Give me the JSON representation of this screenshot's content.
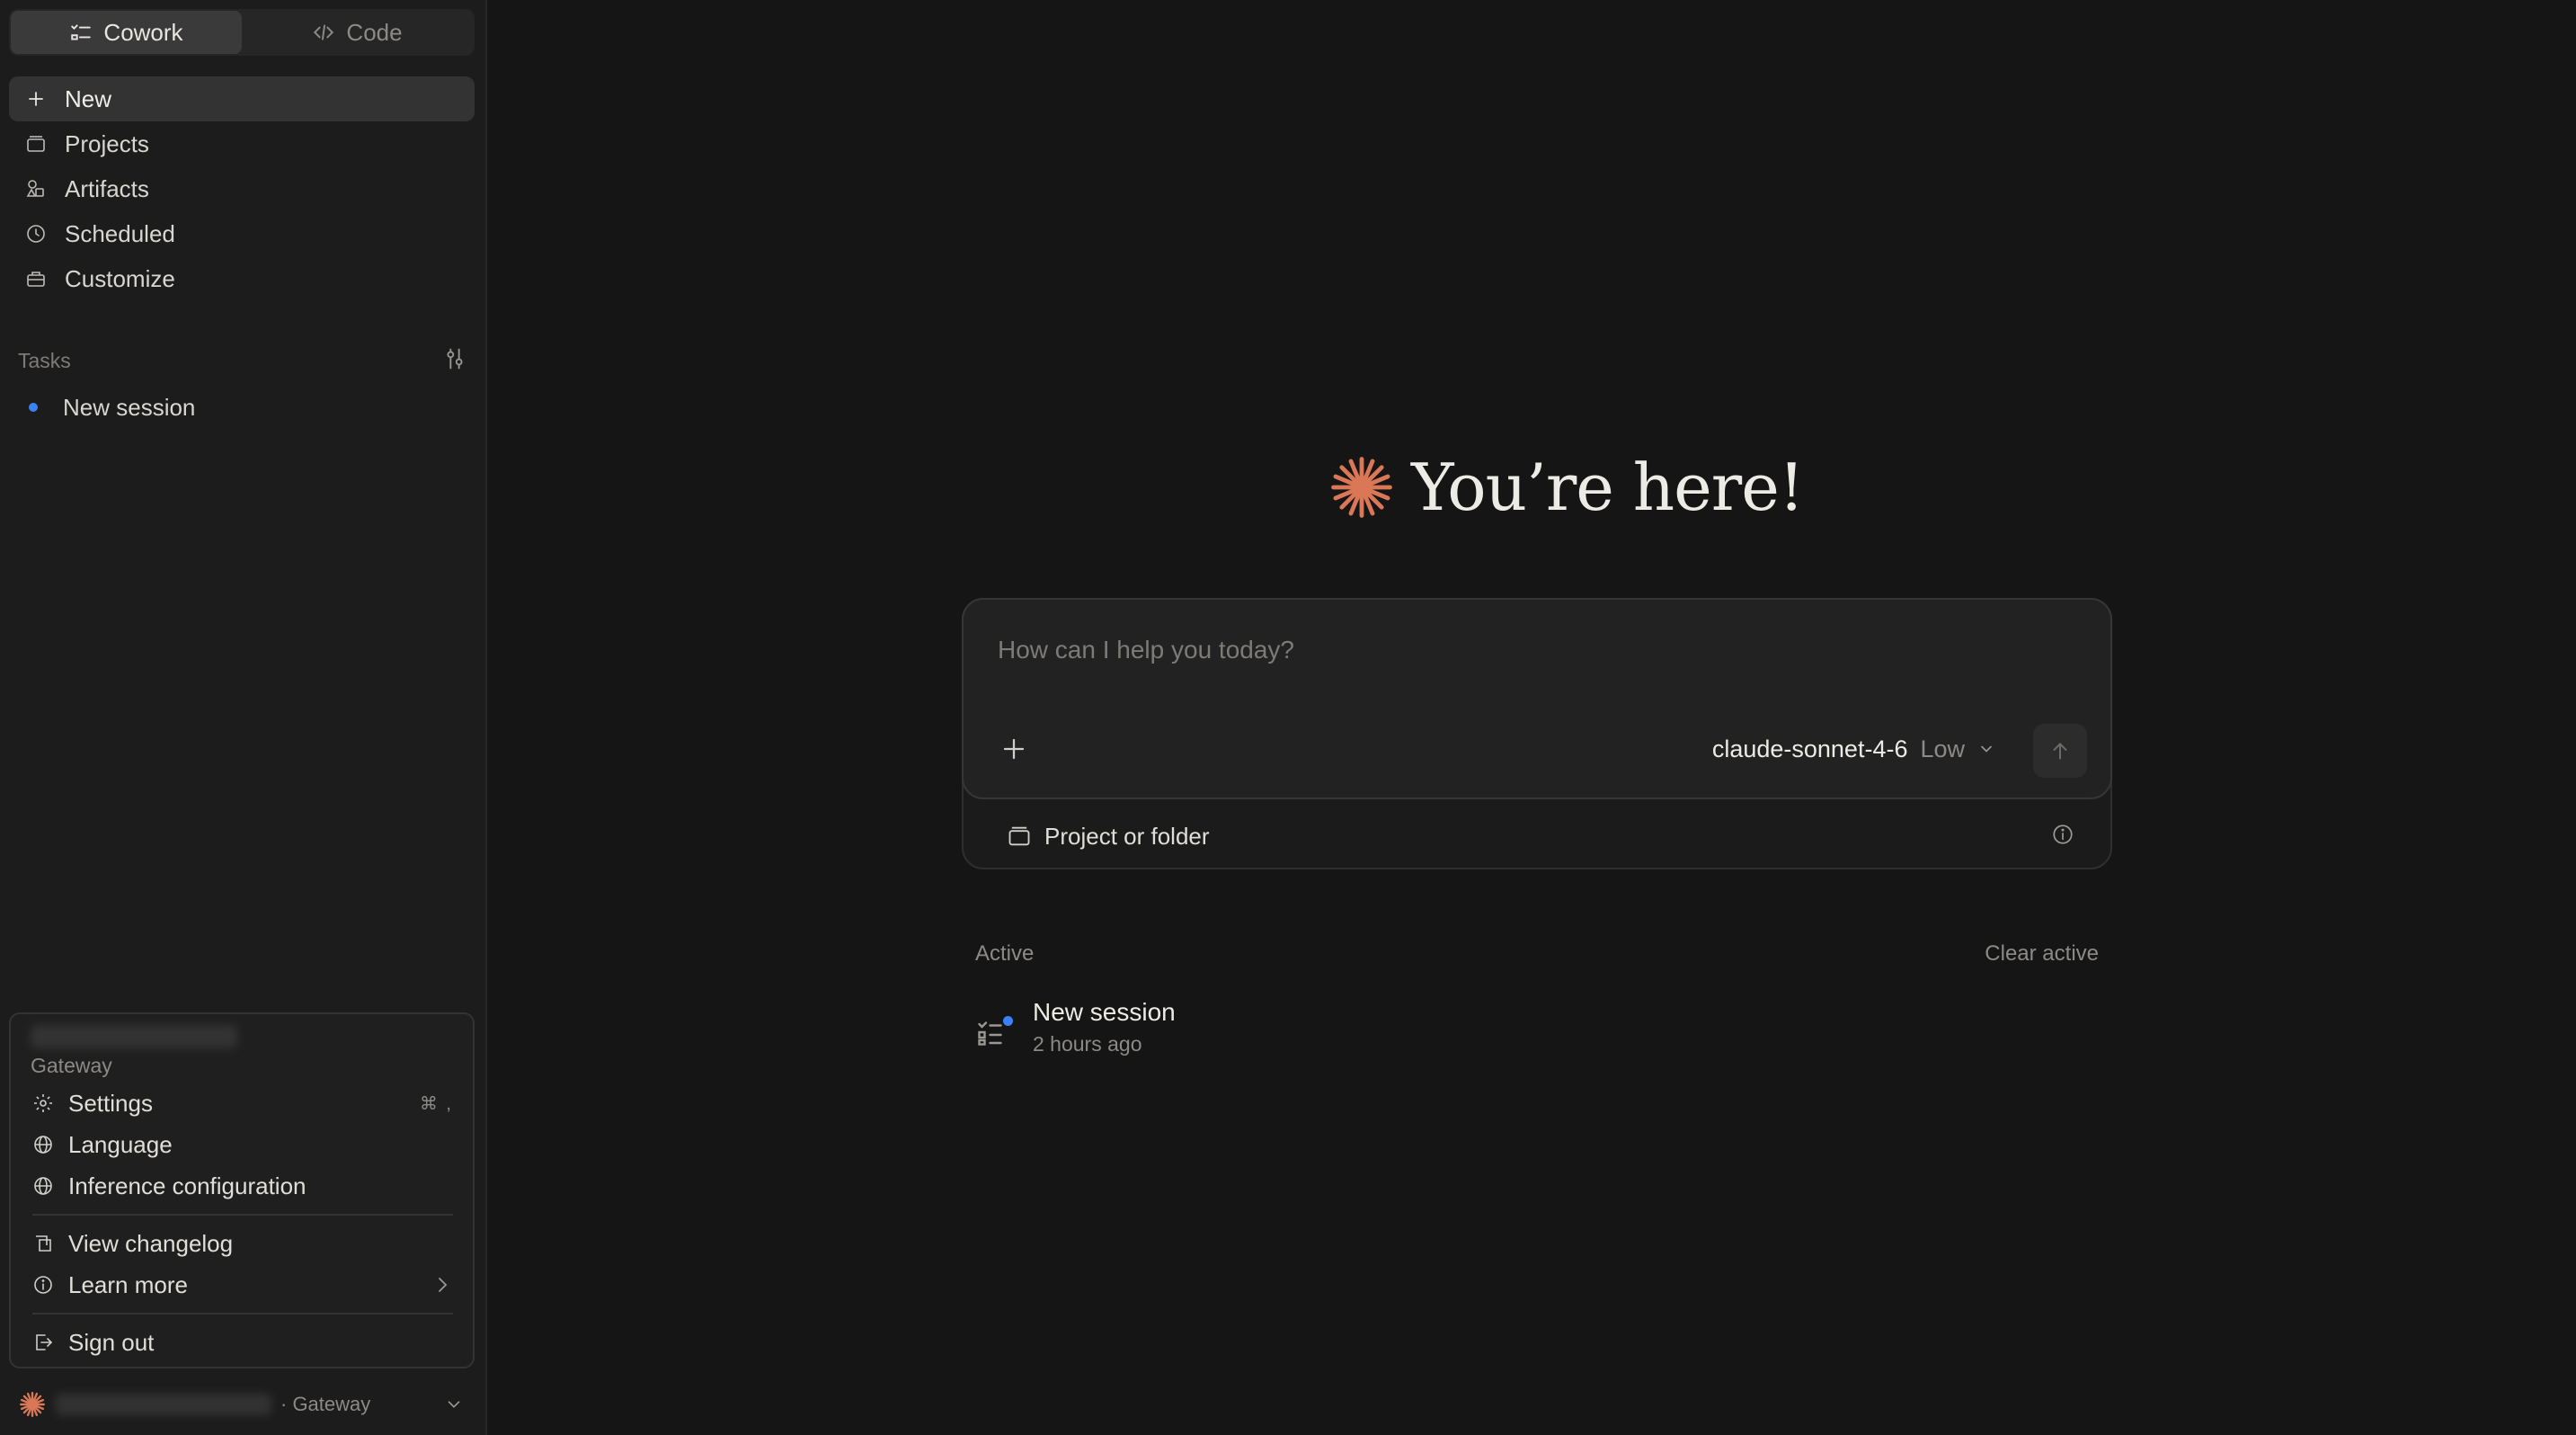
{
  "sidebar": {
    "mode_tabs": [
      {
        "label": "Cowork",
        "icon": "checklist-icon",
        "active": true
      },
      {
        "label": "Code",
        "icon": "code-icon",
        "active": false
      }
    ],
    "nav_items": [
      {
        "label": "New",
        "icon": "plus-icon",
        "active": true
      },
      {
        "label": "Projects",
        "icon": "folder-icon"
      },
      {
        "label": "Artifacts",
        "icon": "shapes-icon"
      },
      {
        "label": "Scheduled",
        "icon": "clock-icon"
      },
      {
        "label": "Customize",
        "icon": "briefcase-icon"
      }
    ],
    "tasks": {
      "title": "Tasks",
      "items": [
        {
          "label": "New session",
          "status_color": "#3b82f6"
        }
      ]
    }
  },
  "account_menu": {
    "org": "Gateway",
    "items": [
      {
        "label": "Settings",
        "icon": "gear-icon",
        "shortcut": "⌘ ,"
      },
      {
        "label": "Language",
        "icon": "globe-icon"
      },
      {
        "label": "Inference configuration",
        "icon": "globe-icon"
      },
      {
        "label": "View changelog",
        "icon": "changelog-icon"
      },
      {
        "label": "Learn more",
        "icon": "info-icon"
      },
      {
        "label": "Sign out",
        "icon": "sign-out-icon"
      }
    ]
  },
  "user_bar": {
    "org": "· Gateway"
  },
  "main": {
    "hero_title": "You’re here!",
    "composer": {
      "placeholder": "How can I help you today?",
      "model": "claude-sonnet-4-6",
      "effort": "Low",
      "project_label": "Project or folder"
    },
    "active": {
      "title": "Active",
      "clear_label": "Clear active",
      "sessions": [
        {
          "title": "New session",
          "time": "2 hours ago"
        }
      ]
    }
  },
  "colors": {
    "accent": "#d97757",
    "status_blue": "#3b82f6",
    "background": "#151515",
    "sidebar": "#1c1c1c"
  }
}
